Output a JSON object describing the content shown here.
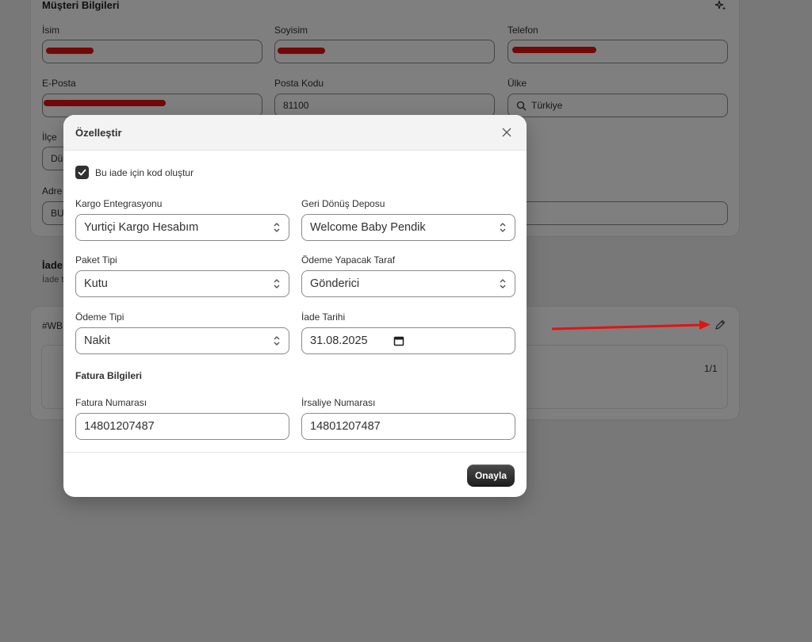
{
  "customer": {
    "section_title": "Müşteri Bilgileri",
    "name_label": "İsim",
    "surname_label": "Soyisim",
    "phone_label": "Telefon",
    "email_label": "E-Posta",
    "postal_label": "Posta Kodu",
    "postal_value": "81100",
    "country_label": "Ülke",
    "country_value": "Türkiye",
    "district_label": "İlçe",
    "district_value": "Dü",
    "address_label": "Adre",
    "address_value": "BU"
  },
  "returns": {
    "section_title": "İade",
    "sub_text": "İade t",
    "order_id": "#WB",
    "page_count": "1/1"
  },
  "modal": {
    "title": "Özelleştir",
    "checkbox_label": "Bu iade için kod oluştur",
    "checkbox_checked": true,
    "cargo_label": "Kargo Entegrasyonu",
    "cargo_value": "Yurtiçi Kargo Hesabım",
    "warehouse_label": "Geri Dönüş Deposu",
    "warehouse_value": "Welcome Baby Pendik",
    "package_label": "Paket Tipi",
    "package_value": "Kutu",
    "payer_label": "Ödeme Yapacak Taraf",
    "payer_value": "Gönderici",
    "payment_label": "Ödeme Tipi",
    "payment_value": "Nakit",
    "date_label": "İade Tarihi",
    "date_value": "31.08.2025",
    "invoice_section": "Fatura Bilgileri",
    "invoice_no_label": "Fatura Numarası",
    "invoice_no_value": "14801207487",
    "waybill_label": "İrsaliye Numarası",
    "waybill_value": "14801207487",
    "confirm_label": "Onayla"
  },
  "colors": {
    "overlay": "#000000",
    "annotation_red": "#e31313",
    "primary_button": "#303030"
  },
  "icons": [
    "sparkle-icon",
    "search-icon",
    "close-icon",
    "check-icon",
    "chevron-updown-icon",
    "calendar-icon",
    "pencil-icon"
  ]
}
